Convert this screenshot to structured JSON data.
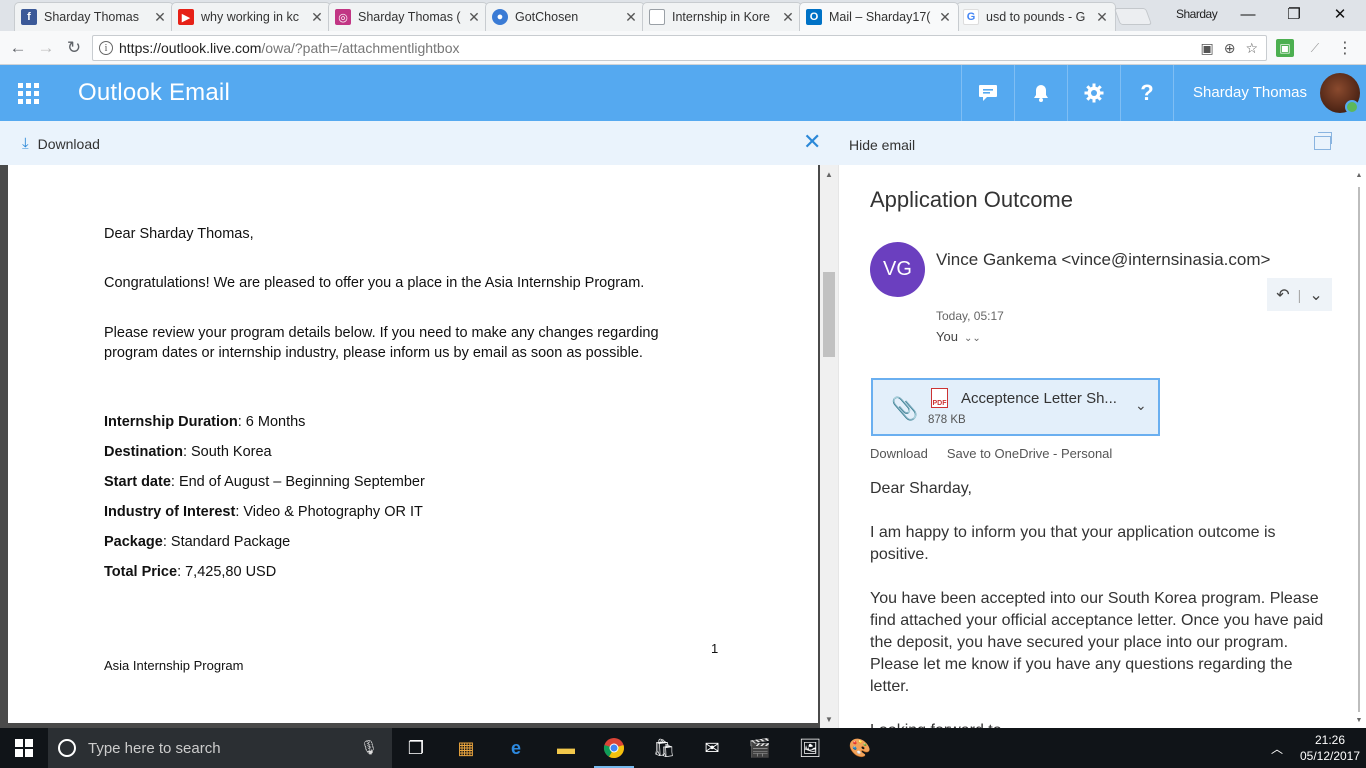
{
  "browser": {
    "tabs": [
      {
        "label": "Sharday Thomas",
        "icon": "facebook-icon",
        "color": "#3b5998"
      },
      {
        "label": "why working in kc",
        "icon": "youtube-icon",
        "color": "#e62117"
      },
      {
        "label": "Sharday Thomas (",
        "icon": "instagram-icon",
        "color": "#c13584"
      },
      {
        "label": "GotChosen",
        "icon": "gotchosen-icon",
        "color": "#3a7bd5"
      },
      {
        "label": "Internship in Kore",
        "icon": "page-icon",
        "color": "#9aa0a6"
      },
      {
        "label": "Mail – Sharday17(",
        "icon": "outlook-icon",
        "color": "#0072c6"
      },
      {
        "label": "usd to pounds - G",
        "icon": "google-icon",
        "color": "#4285f4"
      }
    ],
    "profile_name": "Sharday",
    "url_host": "https://outlook.live.com",
    "url_rest": "/owa/?path=/attachmentlightbox"
  },
  "header": {
    "app_title": "Outlook Email",
    "user_name": "Sharday Thomas",
    "accent": "#55a9f0"
  },
  "commands": {
    "download": "Download",
    "hide_email": "Hide email"
  },
  "document": {
    "greeting": "Dear Sharday Thomas,",
    "para1": "Congratulations! We are pleased to offer you a place in the Asia Internship Program.",
    "para2_line1": "Please review your program details below. If you need to make any changes regarding",
    "para2_line2": "program dates or internship industry, please inform us by email as soon as possible.",
    "details": [
      {
        "label": "Internship Duration",
        "value": ": 6 Months"
      },
      {
        "label": "Destination",
        "value": ": South Korea"
      },
      {
        "label": "Start date",
        "value": ": End of August – Beginning September"
      },
      {
        "label": "Industry of Interest",
        "value": ": Video & Photography OR IT"
      },
      {
        "label": "Package",
        "value": ": Standard Package"
      },
      {
        "label": "Total Price",
        "value": ": 7,425,80 USD"
      }
    ],
    "page_number": "1",
    "footer": "Asia Internship Program"
  },
  "email": {
    "subject": "Application Outcome",
    "sender_initials": "VG",
    "sender": "Vince Gankema <vince@internsinasia.com>",
    "timestamp": "Today, 05:17",
    "to": "You",
    "attachment": {
      "name": "Acceptence Letter Sh...",
      "size": "878 KB"
    },
    "attachment_actions": {
      "download": "Download",
      "save": "Save to OneDrive - Personal"
    },
    "body": {
      "greeting": "Dear Sharday,",
      "para1": "I am happy to inform you that your application outcome is positive.",
      "para2": "You have been accepted into our South Korea program. Please find attached your official acceptance letter. Once you have paid the deposit, you have secured your place into our program. Please let me know if you have any questions regarding the letter.",
      "para3_partial": "Looking forward to..."
    }
  },
  "taskbar": {
    "search_placeholder": "Type here to search",
    "time": "21:26",
    "date": "05/12/2017"
  }
}
